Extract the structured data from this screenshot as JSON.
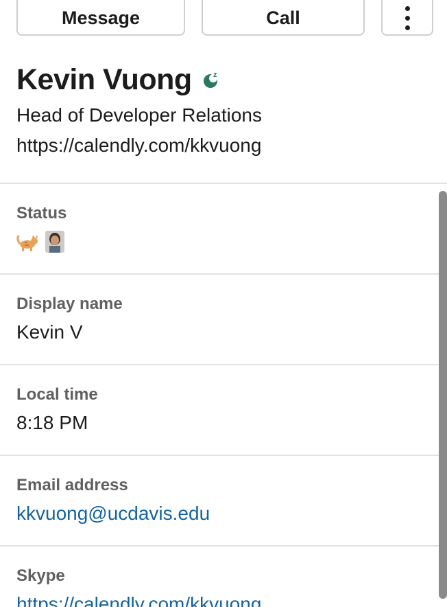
{
  "actions": {
    "message_label": "Message",
    "call_label": "Call",
    "more_icon": "vertical-ellipsis-icon"
  },
  "profile": {
    "name": "Kevin Vuong",
    "presence_icon": "away-zzz-icon",
    "presence_color": "#2b7a5d",
    "title": "Head of Developer Relations",
    "link": "https://calendly.com/kkvuong"
  },
  "fields": {
    "status": {
      "label": "Status",
      "emojis": [
        "cat-emoji",
        "person-photo-emoji"
      ]
    },
    "display_name": {
      "label": "Display name",
      "value": "Kevin V"
    },
    "local_time": {
      "label": "Local time",
      "value": "8:18 PM"
    },
    "email": {
      "label": "Email address",
      "value": "kkvuong@ucdavis.edu"
    },
    "skype": {
      "label": "Skype",
      "value": "https://calendly.com/kkvuong"
    }
  },
  "colors": {
    "link": "#1264a3",
    "label": "#616061",
    "divider": "#e2e2e2"
  }
}
